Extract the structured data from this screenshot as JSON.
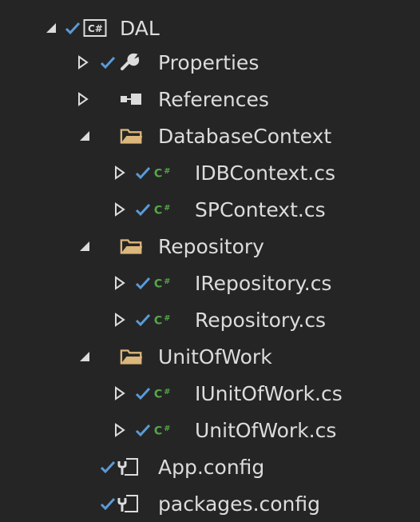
{
  "tree": {
    "root": {
      "label": "DAL",
      "icon": "csharp-project-icon",
      "expanded": true
    },
    "properties": {
      "label": "Properties",
      "icon": "wrench-icon",
      "expanded": false
    },
    "references": {
      "label": "References",
      "icon": "references-icon",
      "expanded": false
    },
    "database_context": {
      "label": "DatabaseContext",
      "icon": "folder-open-icon",
      "expanded": true
    },
    "idbcontext": {
      "label": "IDBContext.cs",
      "icon": "csharp-file-icon",
      "expanded": false
    },
    "spcontext": {
      "label": "SPContext.cs",
      "icon": "csharp-file-icon",
      "expanded": false
    },
    "repository_folder": {
      "label": "Repository",
      "icon": "folder-open-icon",
      "expanded": true
    },
    "irepository": {
      "label": "IRepository.cs",
      "icon": "csharp-file-icon",
      "expanded": false
    },
    "repository_file": {
      "label": "Repository.cs",
      "icon": "csharp-file-icon",
      "expanded": false
    },
    "unitofwork_folder": {
      "label": "UnitOfWork",
      "icon": "folder-open-icon",
      "expanded": true
    },
    "iunitofwork": {
      "label": "IUnitOfWork.cs",
      "icon": "csharp-file-icon",
      "expanded": false
    },
    "unitofwork_file": {
      "label": "UnitOfWork.cs",
      "icon": "csharp-file-icon",
      "expanded": false
    },
    "app_config": {
      "label": "App.config",
      "icon": "config-file-icon"
    },
    "packages_config": {
      "label": "packages.config",
      "icon": "config-file-icon"
    }
  },
  "colors": {
    "background": "#252526",
    "text": "#dcdcdc",
    "checkmark": "#5b9bd5",
    "csharp_green": "#57a64a",
    "folder": "#dcb67a"
  }
}
